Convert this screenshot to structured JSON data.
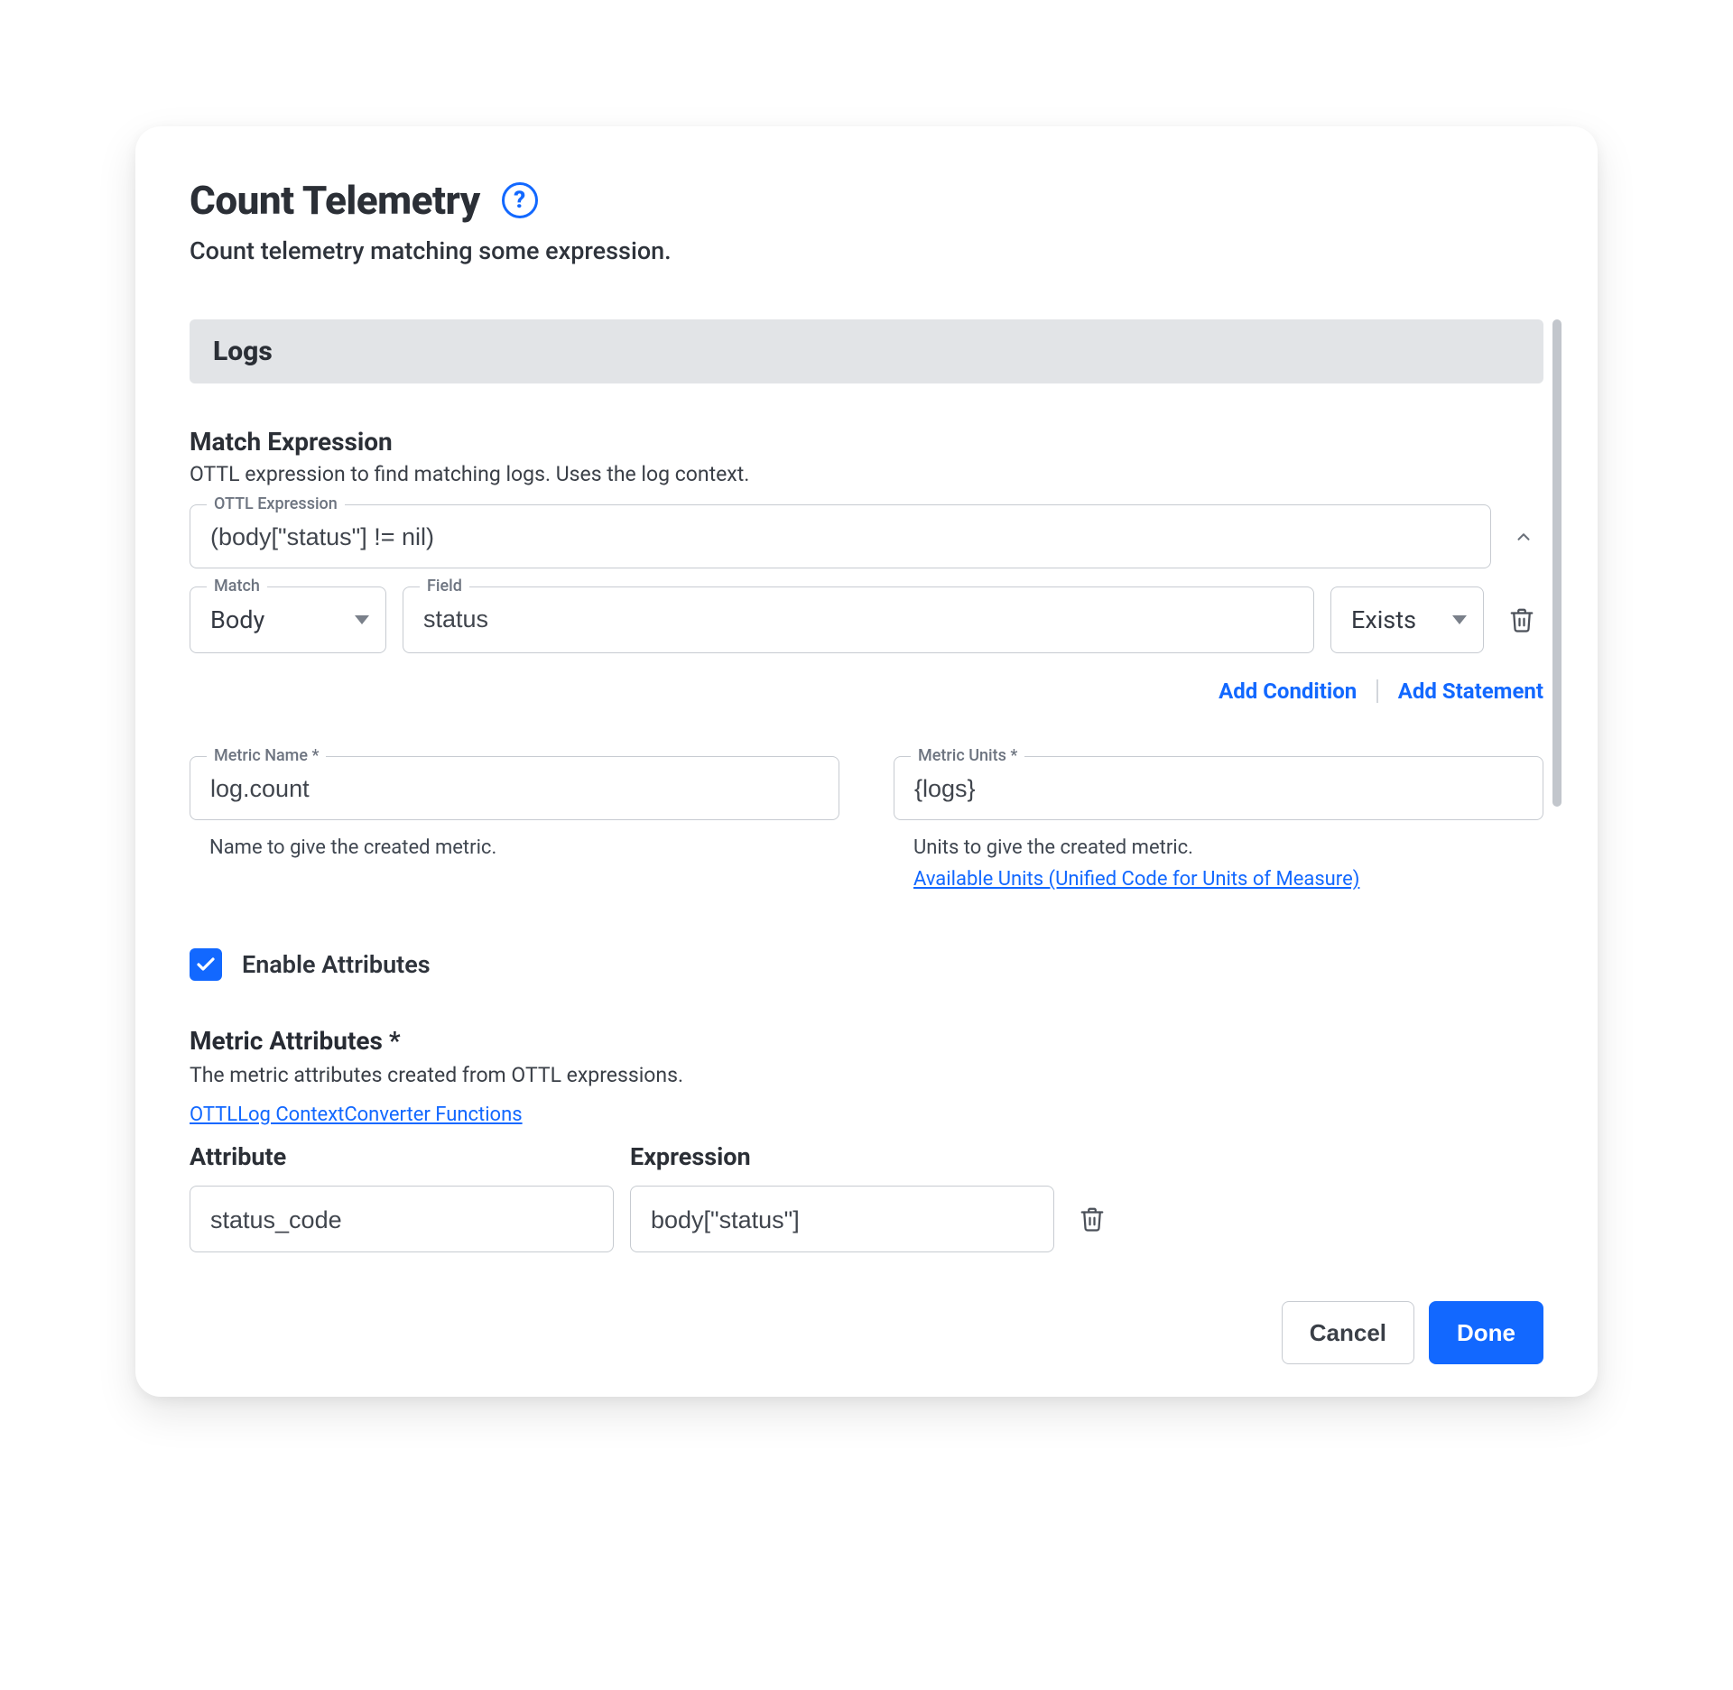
{
  "header": {
    "title": "Count Telemetry",
    "subtitle": "Count telemetry matching some expression."
  },
  "section": {
    "label": "Logs"
  },
  "match": {
    "title": "Match Expression",
    "desc": "OTTL expression to find matching logs. Uses the log context.",
    "expr_label": "OTTL Expression",
    "expr_value": "(body[\"status\"] != nil)",
    "match_label": "Match",
    "match_value": "Body",
    "field_label": "Field",
    "field_value": "status",
    "exists_value": "Exists",
    "add_condition": "Add Condition",
    "add_statement": "Add Statement"
  },
  "metric": {
    "name_label": "Metric Name *",
    "name_value": "log.count",
    "name_helper": "Name to give the created metric.",
    "units_label": "Metric Units *",
    "units_value": "{logs}",
    "units_helper": "Units to give the created metric.",
    "units_link": "Available Units (Unified Code for Units of Measure)"
  },
  "enable_attributes": {
    "label": "Enable Attributes",
    "checked": true
  },
  "attributes": {
    "title": "Metric Attributes *",
    "desc": "The metric attributes created from OTTL expressions.",
    "help_link": "OTTLLog ContextConverter Functions",
    "col_attr": "Attribute",
    "col_expr": "Expression",
    "rows": [
      {
        "attr": "status_code",
        "expr": "body[\"status\"]"
      }
    ]
  },
  "buttons": {
    "cancel": "Cancel",
    "done": "Done"
  }
}
